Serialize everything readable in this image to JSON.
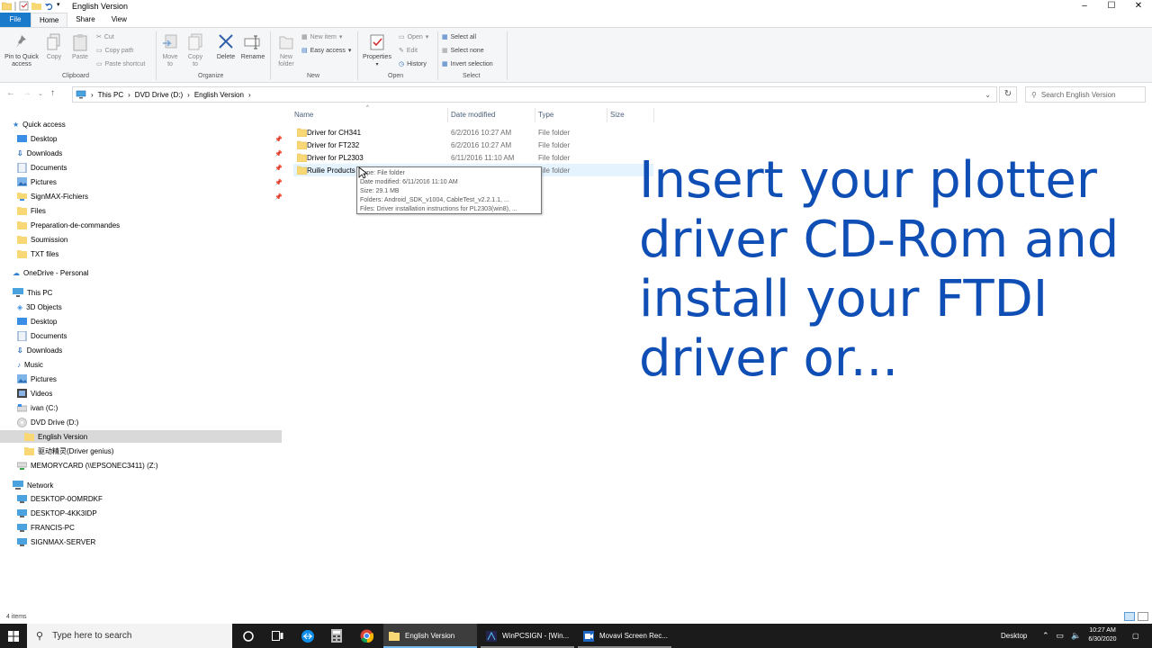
{
  "window": {
    "title": "English Version",
    "controls": [
      "–",
      "☐",
      "✕"
    ]
  },
  "ribbon_tabs": [
    "File",
    "Home",
    "Share",
    "View"
  ],
  "ribbon": {
    "clipboard": {
      "pin_label": "Pin to Quick access",
      "copy_label": "Copy",
      "paste_label": "Paste",
      "cut_label": "Cut",
      "copy_path_label": "Copy path",
      "paste_shortcut_label": "Paste shortcut",
      "group_label": "Clipboard"
    },
    "organize": {
      "move_to_label": "Move to",
      "copy_to_label": "Copy to",
      "delete_label": "Delete",
      "rename_label": "Rename",
      "group_label": "Organize"
    },
    "new": {
      "new_folder_label": "New folder",
      "new_item_label": "New item",
      "easy_access_label": "Easy access",
      "group_label": "New"
    },
    "open": {
      "properties_label": "Properties",
      "open_label": "Open",
      "edit_label": "Edit",
      "history_label": "History",
      "group_label": "Open"
    },
    "select": {
      "select_all_label": "Select all",
      "select_none_label": "Select none",
      "invert_label": "Invert selection",
      "group_label": "Select"
    }
  },
  "address": {
    "crumbs": [
      "This PC",
      "DVD Drive (D:)",
      "English Version"
    ],
    "search_placeholder": "Search English Version"
  },
  "nav_pane": {
    "quick_access": "Quick access",
    "quick_items": [
      "Desktop",
      "Downloads",
      "Documents",
      "Pictures",
      "SignMAX-Fichiers",
      "Files",
      "Preparation-de-commandes",
      "Soumission",
      "TXT files"
    ],
    "onedrive": "OneDrive - Personal",
    "this_pc": "This PC",
    "pc_items": [
      "3D Objects",
      "Desktop",
      "Documents",
      "Downloads",
      "Music",
      "Pictures",
      "Videos",
      "ivan (C:)",
      "DVD Drive (D:)"
    ],
    "dvd_children": [
      "English Version",
      "驱动精灵(Driver genius)"
    ],
    "memorycard": "MEMORYCARD (\\\\EPSONEC3411) (Z:)",
    "network": "Network",
    "network_items": [
      "DESKTOP-0OMRDKF",
      "DESKTOP-4KK3IDP",
      "FRANCIS-PC",
      "SIGNMAX-SERVER"
    ]
  },
  "file_list": {
    "columns": [
      "Name",
      "Date modified",
      "Type",
      "Size"
    ],
    "rows": [
      {
        "name": "Driver for CH341",
        "date": "6/2/2016 10:27 AM",
        "type": "File folder"
      },
      {
        "name": "Driver for FT232",
        "date": "6/2/2016 10:27 AM",
        "type": "File folder"
      },
      {
        "name": "Driver for PL2303",
        "date": "6/11/2016 11:10 AM",
        "type": "File folder"
      },
      {
        "name": "Ruilie Products",
        "date": "",
        "type": "ile folder"
      }
    ]
  },
  "tooltip": {
    "line1": "Type: File folder",
    "line2": "Date modified: 6/11/2016 11:10 AM",
    "line3": "Size: 29.1 MB",
    "line4": "Folders: Android_SDK_v1004, CableTest_v2.2.1.1, ...",
    "line5": "Files: Driver installation instructions for PL2303(win8), ..."
  },
  "overlay": {
    "line1": "Insert your plotter",
    "line2": "driver CD-Rom and",
    "line3": "install your FTDI",
    "line4": "driver or..."
  },
  "status": {
    "items": "4 items"
  },
  "taskbar": {
    "search_placeholder": "Type here to search",
    "apps": [
      "English Version",
      "WinPCSIGN - [Win...",
      "Movavi Screen Rec..."
    ],
    "desktop_label": "Desktop",
    "time": "10:27 AM",
    "date": "6/30/2020"
  },
  "colors": {
    "accent": "#1979ca",
    "overlay_text": "#0f4eb4",
    "folder": "#f8d775",
    "taskbar": "#1b1b1b"
  }
}
